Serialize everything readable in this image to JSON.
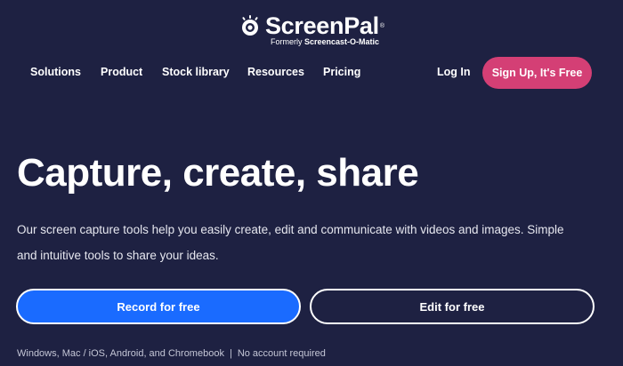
{
  "brand": {
    "name_part1": "Screen",
    "name_part2": "Pal",
    "registered": "®",
    "formerly_prefix": "Formerly ",
    "formerly_name": "Screencast-O-Matic"
  },
  "nav": {
    "items": [
      {
        "label": "Solutions"
      },
      {
        "label": "Product"
      },
      {
        "label": "Stock library"
      },
      {
        "label": "Resources"
      },
      {
        "label": "Pricing"
      }
    ],
    "login_label": "Log In",
    "signup_label": "Sign Up, It's Free"
  },
  "hero": {
    "title": "Capture, create, share",
    "description": "Our screen capture tools help you easily create, edit and communicate with videos and images. Simple and intuitive tools to share your ideas."
  },
  "cta": {
    "record_label": "Record for free",
    "edit_label": "Edit for free"
  },
  "footnote": {
    "platforms": "Windows, Mac / iOS, Android, and Chromebook",
    "separator": "|",
    "no_account": "No account required"
  },
  "colors": {
    "background": "#1e2142",
    "signup": "#d43f75",
    "record": "#1a6bff"
  }
}
